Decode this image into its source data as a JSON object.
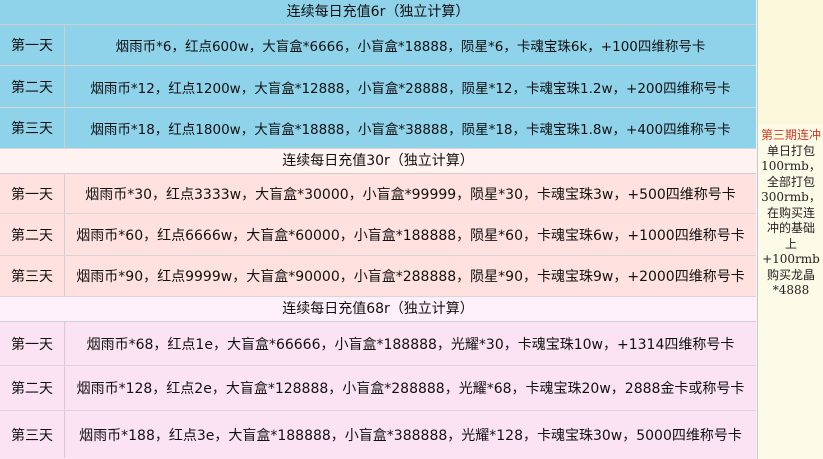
{
  "sections": [
    {
      "title": "连续每日充值6r（独立计算）",
      "rows": [
        {
          "day": "第一天",
          "rewards": "烟雨币*6，红点600w，大盲盒*6666，小盲盒*18888，陨星*6，卡魂宝珠6k，+100四维称号卡"
        },
        {
          "day": "第二天",
          "rewards": "烟雨币*12，红点1200w，大盲盒*12888，小盲盒*28888，陨星*12，卡魂宝珠1.2w，+200四维称号卡"
        },
        {
          "day": "第三天",
          "rewards": "烟雨币*18，红点1800w，大盲盒*18888，小盲盒*38888，陨星*18，卡魂宝珠1.8w，+400四维称号卡"
        }
      ]
    },
    {
      "title": "连续每日充值30r（独立计算）",
      "rows": [
        {
          "day": "第一天",
          "rewards": "烟雨币*30，红点3333w，大盲盒*30000，小盲盒*99999，陨星*30，卡魂宝珠3w，+500四维称号卡"
        },
        {
          "day": "第二天",
          "rewards": "烟雨币*60，红点6666w，大盲盒*60000，小盲盒*188888，陨星*60，卡魂宝珠6w，+1000四维称号卡"
        },
        {
          "day": "第三天",
          "rewards": "烟雨币*90，红点9999w，大盲盒*90000，小盲盒*288888，陨星*90，卡魂宝珠9w，+2000四维称号卡"
        }
      ]
    },
    {
      "title": "连续每日充值68r（独立计算）",
      "rows": [
        {
          "day": "第一天",
          "rewards": "烟雨币*68，红点1e，大盲盒*66666，小盲盒*188888，光耀*30，卡魂宝珠10w，+1314四维称号卡"
        },
        {
          "day": "第二天",
          "rewards": "烟雨币*128，红点2e，大盲盒*128888，小盲盒*288888，光耀*68，卡魂宝珠20w，2888金卡或称号卡"
        },
        {
          "day": "第三天",
          "rewards": "烟雨币*188，红点3e，大盲盒*188888，小盲盒*388888，光耀*128，卡魂宝珠30w，5000四维称号卡"
        }
      ]
    }
  ],
  "side_note": {
    "accent_line": "第三期连冲",
    "lines": [
      "单日打包",
      "100rmb，",
      "全部打包",
      "300rmb，",
      "在购买连",
      "冲的基础",
      "上",
      "+100rmb",
      "购买龙晶",
      "*4888"
    ]
  },
  "colors": {
    "section1_bg": "#8fd3ea",
    "section2_bg": "#ffe2df",
    "section3_bg": "#fbe3f4",
    "side_bg": "#fcfbe8",
    "accent": "#d23a1e"
  }
}
